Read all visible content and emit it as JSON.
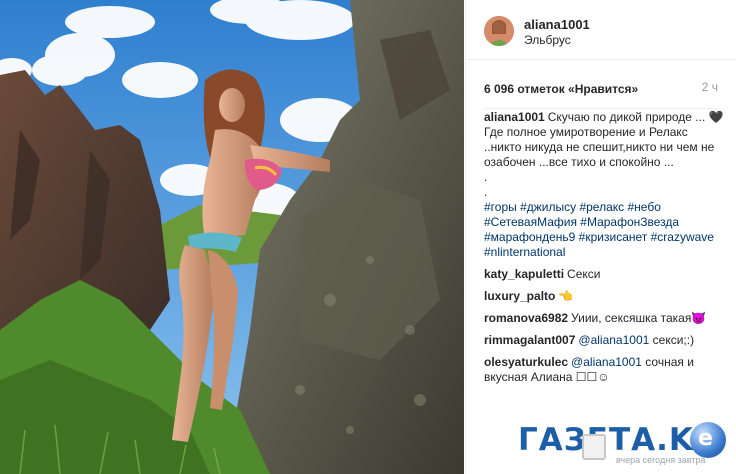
{
  "post": {
    "username": "aliana1001",
    "location": "Эльбрус",
    "likes": "6 096 отметок «Нравится»",
    "time": "2 ч"
  },
  "caption": {
    "user": "aliana1001",
    "lines": [
      "Скучаю по дикой природе ... 🖤",
      "Где полное умиротворение и Релакс",
      "..никто никуда не спешит,никто ни чем не",
      "озабочен ...все тихо и спокойно ...",
      ".",
      "."
    ],
    "hashtags": [
      "#горы #джилысу #релакс #небо",
      "#СетеваяМафия #МарафонЗвезда",
      "#марафондень9 #кризисанет #crazywave",
      "#nlinternational"
    ]
  },
  "comments": [
    {
      "user": "katy_kapuletti",
      "text": "Секси"
    },
    {
      "user": "luxury_palto",
      "text": "👈"
    },
    {
      "user": "romanova6982",
      "text": "Уиии, сексяшка такая😈"
    },
    {
      "user": "rimmagalant007",
      "mention": "@aliana1001",
      "text": "секси;:)"
    },
    {
      "user": "olesyaturkulec",
      "mention": "@aliana1001",
      "text": "сочная и вкусная Алиана ☐☐☺"
    }
  ],
  "watermark": {
    "brand": "ГАЗЕТА.KG",
    "tagline": "вчера сегодня завтра"
  },
  "colors": {
    "text": "#262626",
    "link": "#003569",
    "muted": "#999999",
    "border": "#efefef",
    "sky": "#3f8fd8",
    "rock": "#5b4e44",
    "grass": "#4f8a2c",
    "watermark": "#1c5ea8"
  }
}
